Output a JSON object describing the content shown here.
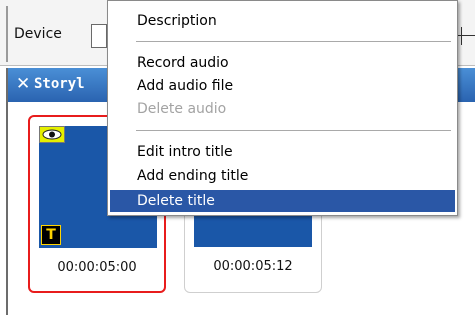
{
  "toolbar": {
    "device_label": "Device"
  },
  "storyboard": {
    "title": "Storyl",
    "clips": [
      {
        "time": "00:00:05:00",
        "selected": true
      },
      {
        "time": "00:00:05:12",
        "selected": false
      }
    ],
    "title_badge": "T"
  },
  "context_menu": {
    "items": [
      {
        "label": "Description",
        "enabled": true
      },
      {
        "label": "Record audio",
        "enabled": true
      },
      {
        "label": "Add audio file",
        "enabled": true
      },
      {
        "label": "Delete audio",
        "enabled": false
      },
      {
        "label": "Edit intro title",
        "enabled": true
      },
      {
        "label": "Add ending title",
        "enabled": true
      },
      {
        "label": "Delete title",
        "enabled": true,
        "highlighted": true
      }
    ]
  },
  "colors": {
    "panel_header": "#2a63b0",
    "selection_border": "#e81c1c",
    "menu_highlight": "#2a57a6"
  }
}
